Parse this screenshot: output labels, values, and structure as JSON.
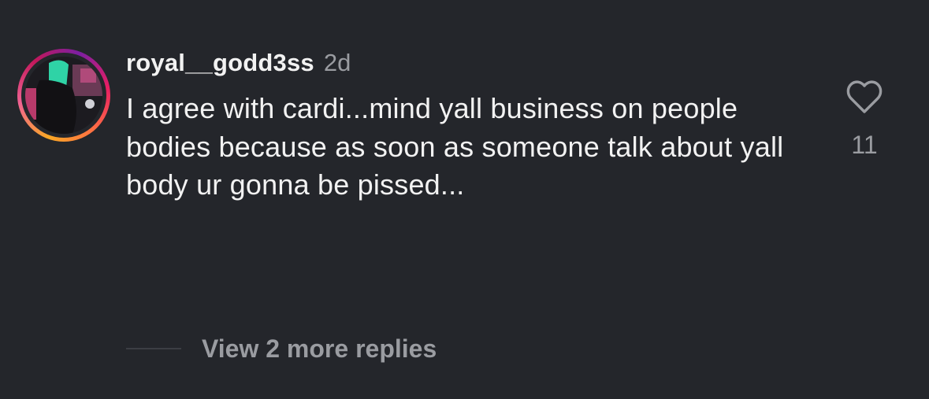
{
  "comment": {
    "username": "royal__godd3ss",
    "timestamp": "2d",
    "text": "I agree with cardi...mind yall business on people bodies because as soon as someone talk about yall body ur gonna be pissed...",
    "like_count": "11",
    "like_icon": "heart-outline-icon"
  },
  "replies": {
    "label": "View 2 more replies"
  },
  "colors": {
    "background": "#24262b",
    "primary_text": "#f2f2f2",
    "secondary_text": "#9a9ca1",
    "story_ring_start": "#f9a825",
    "story_ring_end": "#c2185b"
  }
}
